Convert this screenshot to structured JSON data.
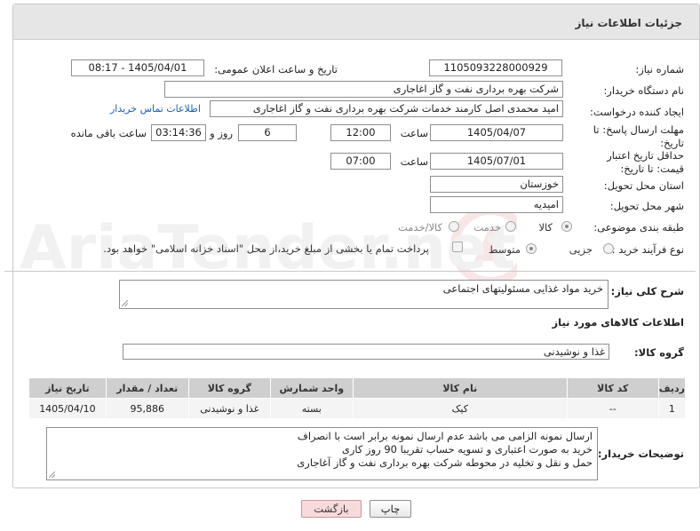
{
  "header": {
    "title": "جزئیات اطلاعات نیاز"
  },
  "form": {
    "need_number_label": "شماره نیاز:",
    "need_number": "1105093228000929",
    "announce_label": "تاریخ و ساعت اعلان عمومی:",
    "announce_value": "1405/04/01 - 08:17",
    "buyer_org_label": "نام دستگاه خریدار:",
    "buyer_org": "شرکت بهره برداری نفت و گاز اغاجاری",
    "creator_label": "ایجاد کننده درخواست:",
    "creator": "امید محمدی اصل کارمند خدمات شرکت بهره برداری نفت و گاز اغاجاری",
    "contact_link": "اطلاعات تماس خریدار",
    "deadline_label": "مهلت ارسال پاسخ: تا تاریخ:",
    "deadline_date": "1405/04/07",
    "time_label": "ساعت",
    "deadline_time": "12:00",
    "days_value": "6",
    "days_label": "روز و",
    "remaining_time": "03:14:36",
    "remaining_label": "ساعت باقی مانده",
    "price_valid_label": "حداقل تاریخ اعتبار قیمت: تا تاریخ:",
    "price_valid_date": "1405/07/01",
    "price_valid_time": "07:00",
    "province_label": "استان محل تحویل:",
    "province": "خوزستان",
    "city_label": "شهر محل تحویل:",
    "city": "امیدیه",
    "category_label": "طبقه بندی موضوعی:",
    "category_options": [
      "کالا",
      "خدمت",
      "کالا/خدمت"
    ],
    "category_selected": "کالا",
    "process_label": "نوع فرآیند خرید :",
    "process_options": [
      "جزیی",
      "متوسط"
    ],
    "process_selected": "متوسط",
    "payment_note": "پرداخت تمام یا بخشی از مبلغ خرید،از محل \"اسناد خزانه اسلامی\" خواهد بود."
  },
  "description": {
    "label": "شرح کلی نیاز:",
    "value": "خرید مواد غذایی مسئولیتهای اجتماعی"
  },
  "goods_info": {
    "title": "اطلاعات کالاهای مورد نیاز",
    "group_label": "گروه کالا:",
    "group_value": "غذا و نوشیدنی"
  },
  "table": {
    "headers": [
      "ردیف",
      "کد کالا",
      "نام کالا",
      "واحد شمارش",
      "گروه کالا",
      "تعداد / مقدار",
      "تاریخ نیاز"
    ],
    "rows": [
      [
        "1",
        "--",
        "کیک",
        "بسته",
        "غذا و نوشیدنی",
        "95,886",
        "1405/04/10"
      ]
    ]
  },
  "buyer_notes": {
    "label": "توضیحات خریدار:",
    "lines": [
      "ارسال نمونه الزامی می باشد عدم ارسال نمونه برابر است با انصراف",
      "خرید به صورت اعتباری و تسویه حساب تقریبا  90 روز کاری",
      "حمل و نقل و تخلیه در محوطه  شرکت بهره برداری نفت و گاز آغاجاری"
    ]
  },
  "buttons": {
    "print": "چاپ",
    "back": "بازگشت"
  },
  "watermark": {
    "text": "AriaTender.net"
  }
}
